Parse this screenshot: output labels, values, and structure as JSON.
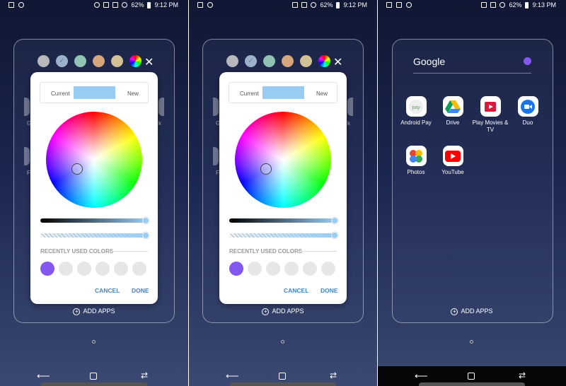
{
  "status": {
    "battery": "62%",
    "time_1": "9:12 PM",
    "time_2": "9:12 PM",
    "time_3": "9:13 PM"
  },
  "swatch_colors": [
    "#b8b9bd",
    "#9db3cc",
    "#8fc4b2",
    "#d6a77c",
    "#d2c295"
  ],
  "picker": {
    "current_label": "Current",
    "new_label": "New",
    "selected_color": "#99ccf3",
    "recently_used_label": "RECENTLY USED COLORS",
    "recent_colors": [
      "#8258f0"
    ],
    "cancel_label": "CANCEL",
    "done_label": "DONE"
  },
  "ghost_labels": {
    "left_1": "G",
    "right_1": "k",
    "left_2": "F"
  },
  "add_apps_label": "ADD APPS",
  "folder": {
    "title": "Google",
    "color": "#8258f0",
    "apps": [
      {
        "label": "Android Pay",
        "icon": "android-pay-icon"
      },
      {
        "label": "Drive",
        "icon": "drive-icon"
      },
      {
        "label": "Play Movies & TV",
        "icon": "play-movies-icon"
      },
      {
        "label": "Duo",
        "icon": "duo-icon"
      },
      {
        "label": "Photos",
        "icon": "photos-icon"
      },
      {
        "label": "YouTube",
        "icon": "youtube-icon"
      }
    ]
  }
}
